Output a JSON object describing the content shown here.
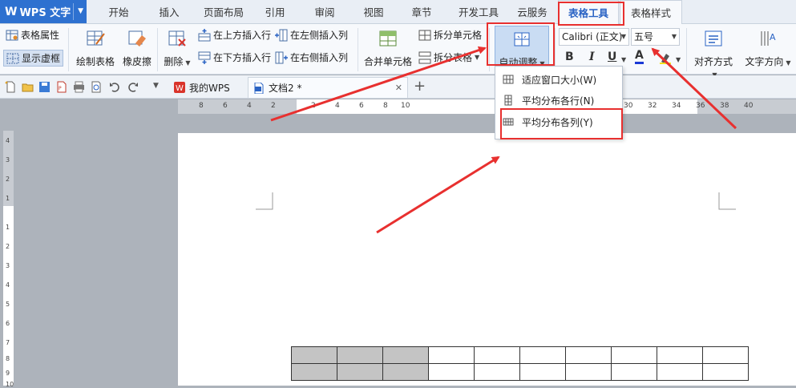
{
  "app": {
    "name": "WPS 文字"
  },
  "tabs": [
    "开始",
    "插入",
    "页面布局",
    "引用",
    "审阅",
    "视图",
    "章节",
    "开发工具",
    "云服务",
    "表格工具",
    "表格样式"
  ],
  "ribbon": {
    "table_props": "表格属性",
    "show_grid": "显示虚框",
    "draw_table": "绘制表格",
    "eraser": "橡皮擦",
    "delete": "删除",
    "insert_above": "在上方插入行",
    "insert_below": "在下方插入行",
    "insert_left": "在左侧插入列",
    "insert_right": "在右侧插入列",
    "merge_cells": "合并单元格",
    "split_cells": "拆分单元格",
    "split_table": "拆分表格",
    "auto_fit": "自动调整",
    "font_name": "Calibri (正文)",
    "font_size": "五号",
    "bold": "B",
    "italic": "I",
    "underline": "U",
    "font_color": "A",
    "align": "对齐方式",
    "text_dir": "文字方向"
  },
  "doc_tabs": [
    "我的WPS",
    "文档2 *"
  ],
  "dropdown": {
    "items": [
      "适应窗口大小(W)",
      "平均分布各行(N)",
      "平均分布各列(Y)"
    ]
  },
  "ruler_h": [
    "8",
    "6",
    "4",
    "2",
    "2",
    "4",
    "6",
    "8",
    "10",
    "30",
    "32",
    "34",
    "36",
    "38",
    "40"
  ],
  "ruler_v": [
    "4",
    "3",
    "2",
    "1",
    "1",
    "2",
    "3",
    "4",
    "5",
    "6",
    "7",
    "8",
    "9",
    "10"
  ],
  "table": {
    "rows": 2,
    "cols": 10,
    "selected_cols": 3
  },
  "colors": {
    "accent": "#2e71d0",
    "annotation": "#e8302f"
  }
}
